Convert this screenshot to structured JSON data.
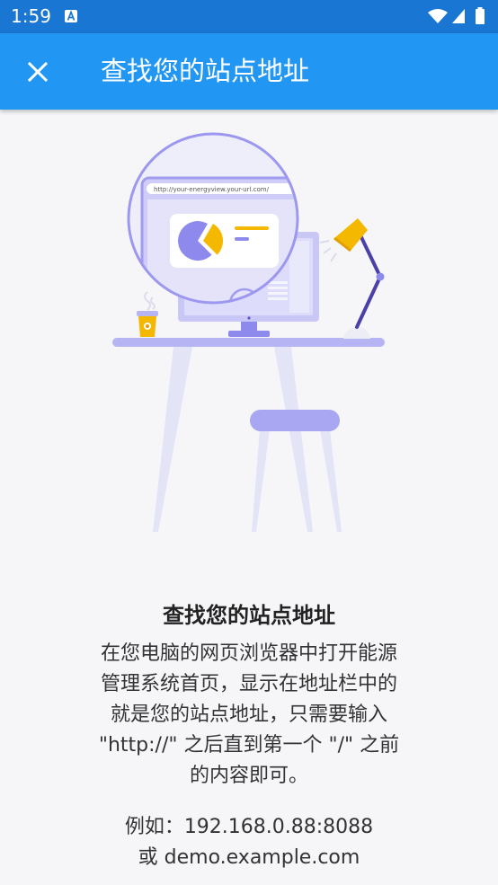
{
  "status_bar": {
    "time": "1:59",
    "icons": [
      "a-badge-icon",
      "wifi-icon",
      "signal-icon",
      "battery-icon"
    ]
  },
  "app_bar": {
    "close_icon": "close-icon",
    "title": "查找您的站点地址"
  },
  "illustration": {
    "url_text": "http://your-energyview.your-url.com/"
  },
  "content": {
    "heading": "查找您的站点地址",
    "description_lines": [
      "在您电脑的网页浏览器中打开能源",
      "管理系统首页，显示在地址栏中的",
      "就是您的站点地址，只需要输入",
      "\"http://\" 之后直到第一个 \"/\" 之前",
      "的内容即可。"
    ],
    "example_lines": [
      "例如：192.168.0.88:8088",
      "或 demo.example.com"
    ]
  },
  "colors": {
    "status_bar": "#1976D2",
    "app_bar": "#2196F3",
    "background": "#F6F6F9",
    "text": "#333333",
    "heading": "#222222",
    "illustration_purple": "#8E89EC",
    "illustration_yellow": "#F5B800"
  }
}
